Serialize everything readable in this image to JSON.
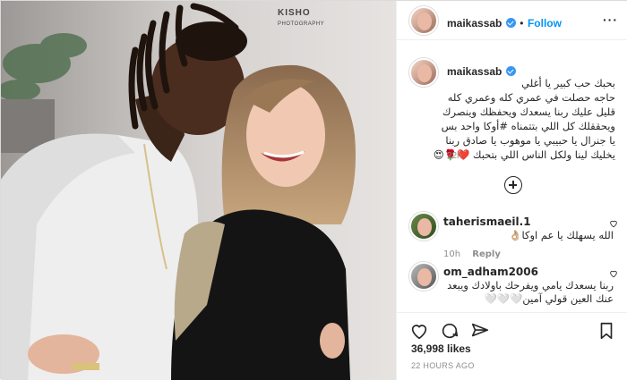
{
  "post": {
    "username": "maikassab",
    "follow_label": "Follow",
    "separator": "•",
    "watermark_main": "KISHO",
    "watermark_sub": "PHOTOGRAPHY",
    "caption_lines": [
      "بحبك حب كبير يا أغلي",
      "حاجه حصلت في عمري كله وعمري كله",
      "قليل عليك ربنا يسعدك ويحفظك وينصرك",
      "ويحققلك كل اللي بتتمناه #أوكا واحد بس",
      "يا جنرال يا حبيبي يا موهوب يا صادق ربنا",
      "يخليك لينا ولكل الناس اللي بتحبك ❤️🌹😍"
    ],
    "caption_time": "22h",
    "likes": "36,998 likes",
    "posted_ago": "22 HOURS AGO"
  },
  "comments": [
    {
      "username": "taherismaeil.1",
      "text": "الله يسهلك يا عم اوكا👌🏼",
      "time": "10h",
      "reply_label": "Reply"
    },
    {
      "username": "om_adham2006",
      "text": "ربنا يسعدك يامي ويفرحك باولادك ويبعد عنك العين قولي آمين🤍🤍🤍",
      "time": "",
      "reply_label": ""
    }
  ],
  "icons": {
    "more": "more-icon",
    "verified": "verified-badge-icon",
    "load_more": "plus-circle-icon",
    "like": "heart-icon",
    "comment": "comment-icon",
    "share": "share-icon",
    "save": "bookmark-icon"
  },
  "colors": {
    "accent": "#0095f6",
    "hashtag": "#00376b",
    "muted": "#8e8e8e"
  }
}
